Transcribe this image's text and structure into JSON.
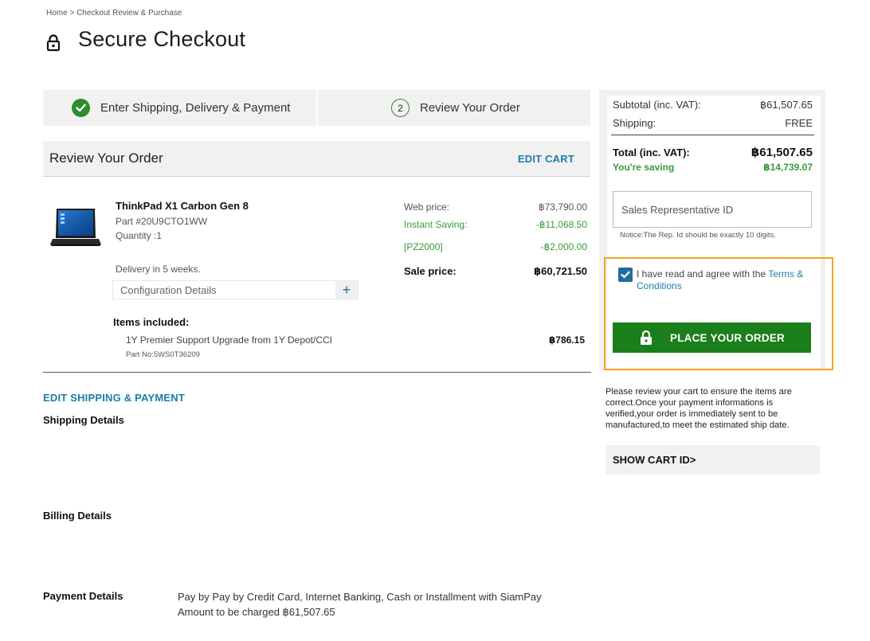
{
  "breadcrumb": "Home > Checkout Review & Purchase",
  "page_title": "Secure Checkout",
  "steps": [
    {
      "label": "Enter Shipping, Delivery & Payment",
      "state": "complete"
    },
    {
      "number": "2",
      "label": "Review Your Order",
      "state": "current"
    }
  ],
  "review": {
    "title": "Review Your Order",
    "edit_cart": "EDIT CART"
  },
  "product": {
    "name": "ThinkPad X1 Carbon Gen 8",
    "part": "Part #20U9CTO1WW",
    "quantity": "Quantity :1",
    "delivery": "Delivery in 5 weeks.",
    "config_label": "Configuration Details",
    "config_toggle": "+",
    "prices": {
      "web_label": "Web price:",
      "web_value": "฿73,790.00",
      "saving_label": "Instant Saving:",
      "saving_value": "-฿11,068.50",
      "promo_label": "[PZ2000]",
      "promo_value": "-฿2,000.00",
      "sale_label": "Sale price:",
      "sale_value": "฿60,721.50"
    },
    "items_title": "Items included:",
    "items": [
      {
        "name": "1Y Premier Support Upgrade from 1Y Depot/CCI",
        "part": "Part No:5WS0T36209",
        "price": "฿786.15"
      }
    ]
  },
  "details": {
    "edit_link": "EDIT SHIPPING & PAYMENT",
    "shipping_title": "Shipping Details",
    "billing_title": "Billing Details",
    "payment_title": "Payment Details",
    "payment_method": "Pay by  Pay by Credit Card, Internet Banking, Cash or Installment with SiamPay",
    "amount_line": "Amount to be charged  ฿61,507.65"
  },
  "summary": {
    "subtotal_label": "Subtotal (inc. VAT):",
    "subtotal_value": "฿61,507.65",
    "shipping_label": "Shipping:",
    "shipping_value": "FREE",
    "total_label": "Total (inc. VAT):",
    "total_value": "฿61,507.65",
    "saving_label": "You're saving",
    "saving_value": "฿14,739.07",
    "rep_placeholder": "Sales Representative ID",
    "rep_notice": "Notice:The Rep. Id should be exactly 10 digits.",
    "agree_text": "I have read and agree with the ",
    "agree_link": "Terms & Conditions",
    "place_order": "PLACE YOUR ORDER",
    "review_note": "Please review your cart to ensure the items are correct.Once your payment informations is verified,your order is immediately sent to be manufactured,to meet the estimated ship date.",
    "show_cart_id": "SHOW CART ID>"
  },
  "colors": {
    "accent_blue": "#1c7fa6",
    "success_green": "#2e8b2e",
    "button_green": "#1a7e1a",
    "highlight_orange": "#f3a51c"
  },
  "icons": [
    "lock-icon",
    "check-icon",
    "laptop-image",
    "plus-icon",
    "checkbox-checked-icon"
  ]
}
